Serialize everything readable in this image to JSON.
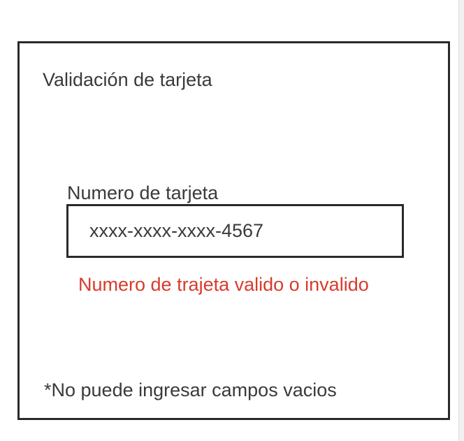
{
  "card": {
    "title": "Validación de tarjeta",
    "field_label": "Numero de tarjeta",
    "input_value": "xxxx-xxxx-xxxx-4567",
    "validation_message": "Numero de trajeta valido o invalido",
    "validation_color": "#d83b2d",
    "footnote": "*No puede ingresar campos vacios"
  }
}
